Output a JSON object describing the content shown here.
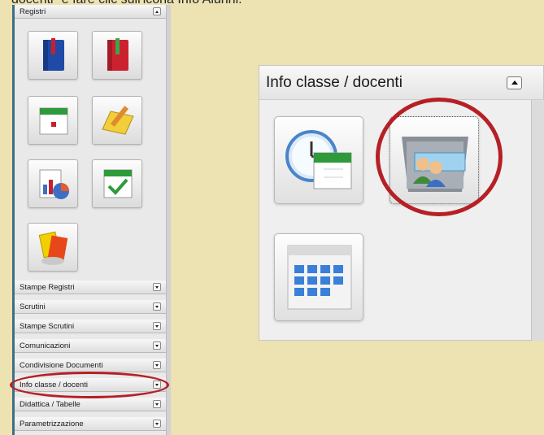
{
  "caption": "docenti\" e fare clic sull'icona Info Alunni.",
  "left_panel": {
    "header": "Registri",
    "sections": [
      "Stampe Registri",
      "Scrutini",
      "Stampe Scrutini",
      "Comunicazioni",
      "Condivisione Documenti",
      "Info classe / docenti",
      "Didattica / Tabelle",
      "Parametrizzazione"
    ]
  },
  "right_panel": {
    "title": "Info classe / docenti"
  },
  "icons": {
    "left_tiles": [
      "register-blue-icon",
      "register-red-icon",
      "calendar-icon",
      "notepad-pencil-icon",
      "chart-report-icon",
      "calendar-check-icon",
      "yellow-cards-icon"
    ],
    "right_tiles": [
      "clock-calendar-icon",
      "info-alunni-icon",
      "calendar-grid-icon"
    ]
  },
  "colors": {
    "background": "#ece2b2",
    "highlight_circle": "#b52026",
    "panel_accent": "#3f6f86"
  }
}
